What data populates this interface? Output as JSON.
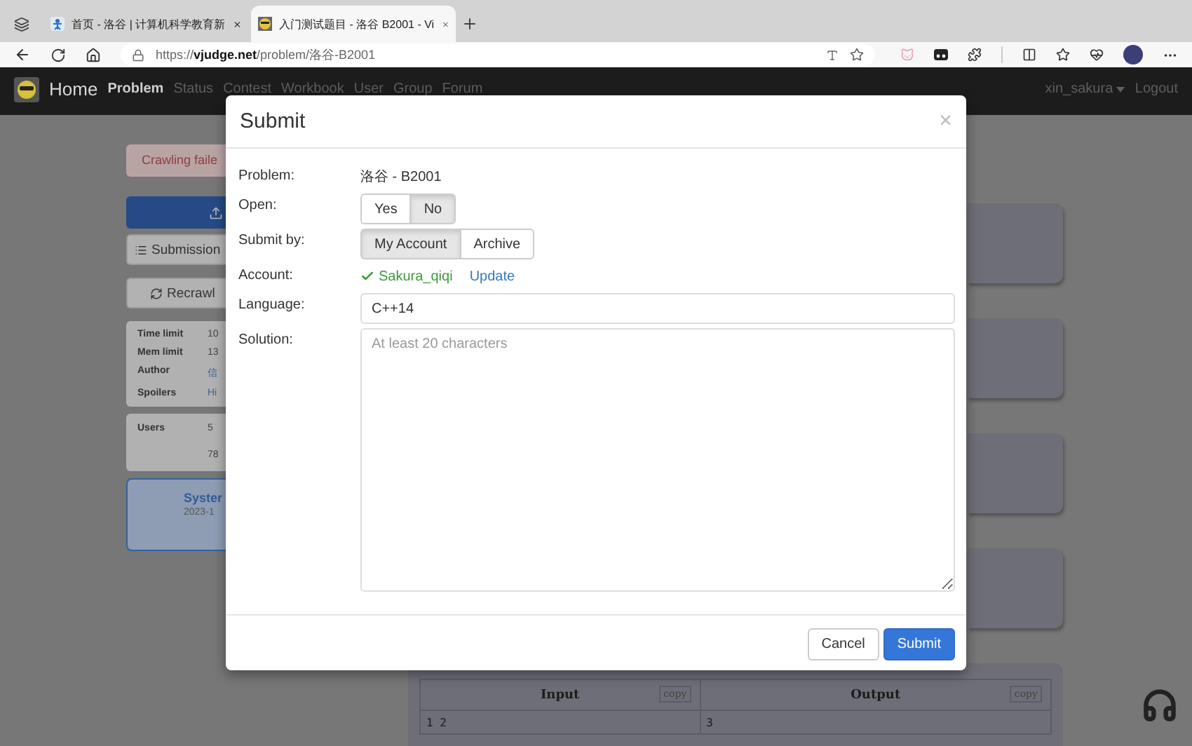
{
  "browser": {
    "tabs": [
      {
        "title": "首页 - 洛谷 | 计算机科学教育新",
        "selected": false
      },
      {
        "title": "入门测试题目 - 洛谷 B2001 - Vi",
        "selected": true
      }
    ],
    "url": "https://**vjudge.net**/problem/洛谷-B2001"
  },
  "navbar": {
    "brand": "Home",
    "items": [
      {
        "label": "Problem",
        "selected": true
      },
      {
        "label": "Status",
        "selected": false
      },
      {
        "label": "Contest",
        "selected": false
      },
      {
        "label": "Workbook",
        "selected": false
      },
      {
        "label": "User",
        "selected": false
      },
      {
        "label": "Group",
        "selected": false
      },
      {
        "label": "Forum",
        "selected": false
      }
    ],
    "user": "xin_sakura",
    "logout": "Logout"
  },
  "sidebar": {
    "alert": "Crawling faile",
    "buttons": [
      "Submission",
      "Recrawl"
    ],
    "info": [
      {
        "label": "Time limit",
        "value": "10"
      },
      {
        "label": "Mem limit",
        "value": "13"
      },
      {
        "label": "Author",
        "value": "信"
      },
      {
        "label": "Spoilers",
        "value": "Hi"
      }
    ],
    "users": {
      "label": "Users",
      "values": [
        "5",
        "78"
      ]
    },
    "system": {
      "title": "Syster",
      "date": "2023-1"
    }
  },
  "samples": {
    "columns": [
      {
        "label": "Input",
        "copy": "copy"
      },
      {
        "label": "Output",
        "copy": "copy"
      }
    ],
    "rows": [
      [
        "1 2",
        "3"
      ]
    ]
  },
  "modal": {
    "title": "Submit",
    "close": "×",
    "problem": {
      "label": "Problem:",
      "value": "洛谷 - B2001"
    },
    "open": {
      "label": "Open:",
      "options": [
        {
          "label": "Yes",
          "selected": false
        },
        {
          "label": "No",
          "selected": true
        }
      ]
    },
    "submit_by": {
      "label": "Submit by:",
      "options": [
        {
          "label": "My Account",
          "selected": true
        },
        {
          "label": "Archive",
          "selected": false
        }
      ]
    },
    "account": {
      "label": "Account:",
      "name": "Sakura_qiqi",
      "link": "Update"
    },
    "language": {
      "label": "Language:",
      "value": "C++14"
    },
    "solution": {
      "label": "Solution:",
      "placeholder": "At least 20 characters"
    },
    "buttons": [
      "Cancel",
      "Submit"
    ]
  }
}
